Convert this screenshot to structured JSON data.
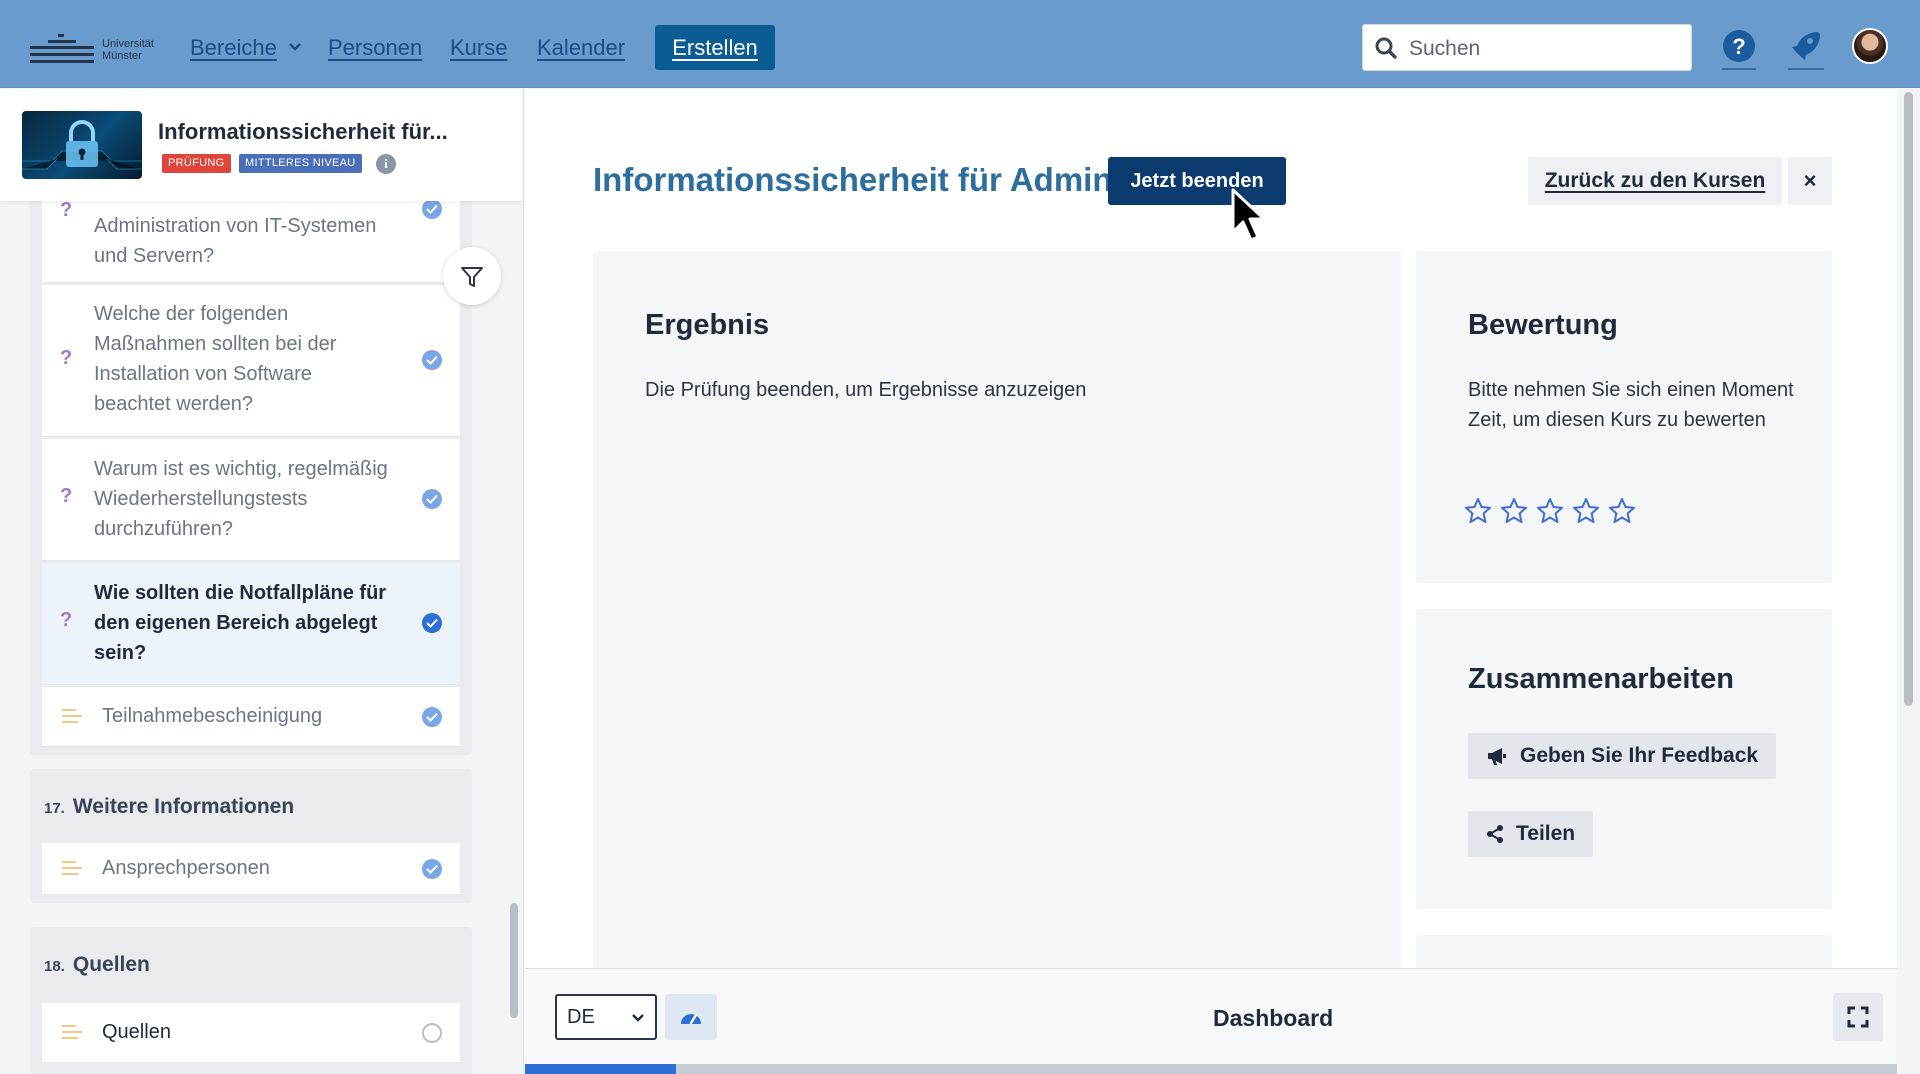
{
  "nav": {
    "logo_text": "Universität\nMünster",
    "links": [
      "Bereiche",
      "Personen",
      "Kurse",
      "Kalender"
    ],
    "create_label": "Erstellen",
    "search_placeholder": "Suchen"
  },
  "course": {
    "title": "Informationssicherheit für...",
    "badges": [
      {
        "label": "PRÜFUNG",
        "color": "#e0453b"
      },
      {
        "label": "MITTLERES NIVEAU",
        "color": "#4a6fb8"
      }
    ]
  },
  "outline": {
    "items": [
      {
        "text": "Administration von IT-Systemen\nund Servern?",
        "type": "question",
        "done": true
      },
      {
        "text": "Welche der folgenden\nMaßnahmen sollten bei der\nInstallation von Software\nbeachtet werden?",
        "type": "question",
        "done": true
      },
      {
        "text": "Warum ist es wichtig, regelmäßig\nWiederherstellungstests\ndurchzuführen?",
        "type": "question",
        "done": true
      },
      {
        "text": "Wie sollten die Notfallpläne für\nden eigenen Bereich abgelegt\nsein?",
        "type": "question",
        "done": true,
        "active": true
      },
      {
        "text": "Teilnahmebescheinigung",
        "type": "page",
        "done": true
      }
    ],
    "sections": [
      {
        "number": "17.",
        "title": "Weitere Informationen",
        "items": [
          {
            "text": "Ansprechpersonen",
            "done": true
          }
        ]
      },
      {
        "number": "18.",
        "title": "Quellen",
        "items": [
          {
            "text": "Quellen",
            "done": false
          }
        ]
      }
    ]
  },
  "main": {
    "title": "Informationssicherheit für Admins",
    "end_button": "Jetzt beenden",
    "back_button": "Zurück zu den Kursen",
    "close_button": "×",
    "result": {
      "heading": "Ergebnis",
      "text": "Die Prüfung beenden, um Ergebnisse anzuzeigen"
    },
    "rating": {
      "heading": "Bewertung",
      "text": "Bitte nehmen Sie sich einen Moment Zeit, um diesen Kurs zu bewerten",
      "stars_filled": 0,
      "stars_total": 5
    },
    "collaborate": {
      "heading": "Zusammenarbeiten",
      "feedback_button": "Geben Sie Ihr Feedback",
      "share_button": "Teilen"
    }
  },
  "bottom": {
    "language": "DE",
    "dashboard_label": "Dashboard",
    "progress_fraction": 0.11
  }
}
